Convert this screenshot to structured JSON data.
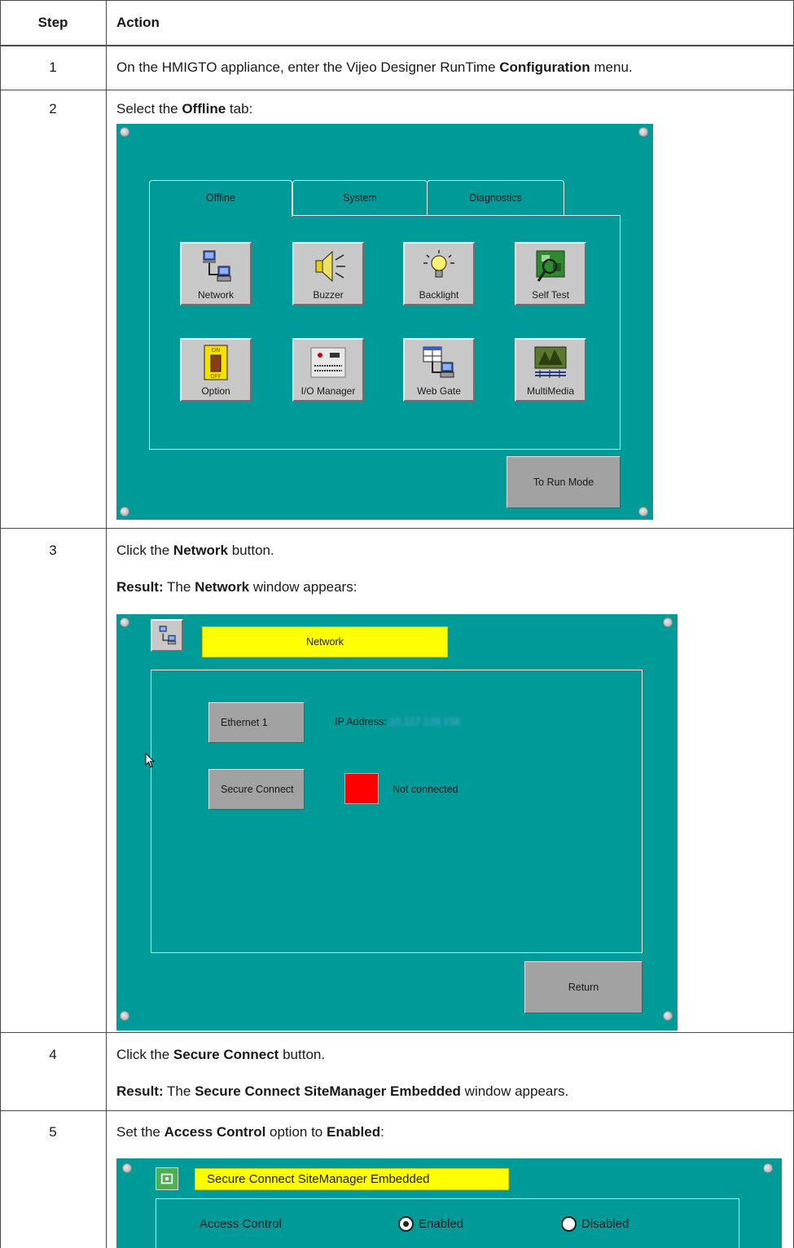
{
  "table": {
    "header": {
      "step": "Step",
      "action": "Action"
    },
    "rows": [
      {
        "step": "1",
        "text_pre": "On the HMIGTO appliance, enter the Vijeo Designer RunTime ",
        "bold": "Configuration",
        "text_post": " menu."
      },
      {
        "step": "2",
        "text_pre": "Select the ",
        "bold": "Offline",
        "text_post": " tab:"
      },
      {
        "step": "3",
        "text_pre": "Click the ",
        "bold": "Network",
        "text_post": " button.",
        "result_label": "Result:",
        "result_pre": " The ",
        "result_bold": "Network",
        "result_post": " window appears:"
      },
      {
        "step": "4",
        "text_pre": "Click the ",
        "bold": "Secure Connect",
        "text_post": " button.",
        "result_label": "Result:",
        "result_pre": " The ",
        "result_bold": "Secure Connect SiteManager Embedded",
        "result_post": " window appears."
      },
      {
        "step": "5",
        "text_pre": "Set the ",
        "bold": "Access Control",
        "text_post": " option to ",
        "bold2": "Enabled",
        "text_post2": ":"
      }
    ]
  },
  "offline_screen": {
    "tabs": [
      "Offline",
      "System",
      "Diagnostics"
    ],
    "active_tab": "Offline",
    "buttons": [
      {
        "label": "Network",
        "icon": "network-icon"
      },
      {
        "label": "Buzzer",
        "icon": "buzzer-icon"
      },
      {
        "label": "Backlight",
        "icon": "backlight-icon"
      },
      {
        "label": "Self Test",
        "icon": "self-test-icon"
      },
      {
        "label": "Option",
        "icon": "option-switch-icon"
      },
      {
        "label": "I/O Manager",
        "icon": "io-manager-icon"
      },
      {
        "label": "Web Gate",
        "icon": "web-gate-icon"
      },
      {
        "label": "MultiMedia",
        "icon": "multimedia-icon"
      }
    ],
    "run_mode_button": "To Run Mode",
    "colors": {
      "panel": "#009a99",
      "button": "#c8c8c8"
    }
  },
  "network_screen": {
    "title": "Network",
    "ethernet_button": "Ethernet 1",
    "ip_label": "IP Address:",
    "ip_value": "10.127.128.158",
    "secure_connect_button": "Secure Connect",
    "status_text": "Not connected",
    "return_button": "Return",
    "colors": {
      "title_bar": "#ffff00",
      "status_indicator": "#ff0000"
    }
  },
  "secure_screen": {
    "title": "Secure Connect SiteManager Embedded",
    "access_control_label": "Access Control",
    "options": [
      "Enabled",
      "Disabled"
    ],
    "selected_option": "Enabled"
  }
}
